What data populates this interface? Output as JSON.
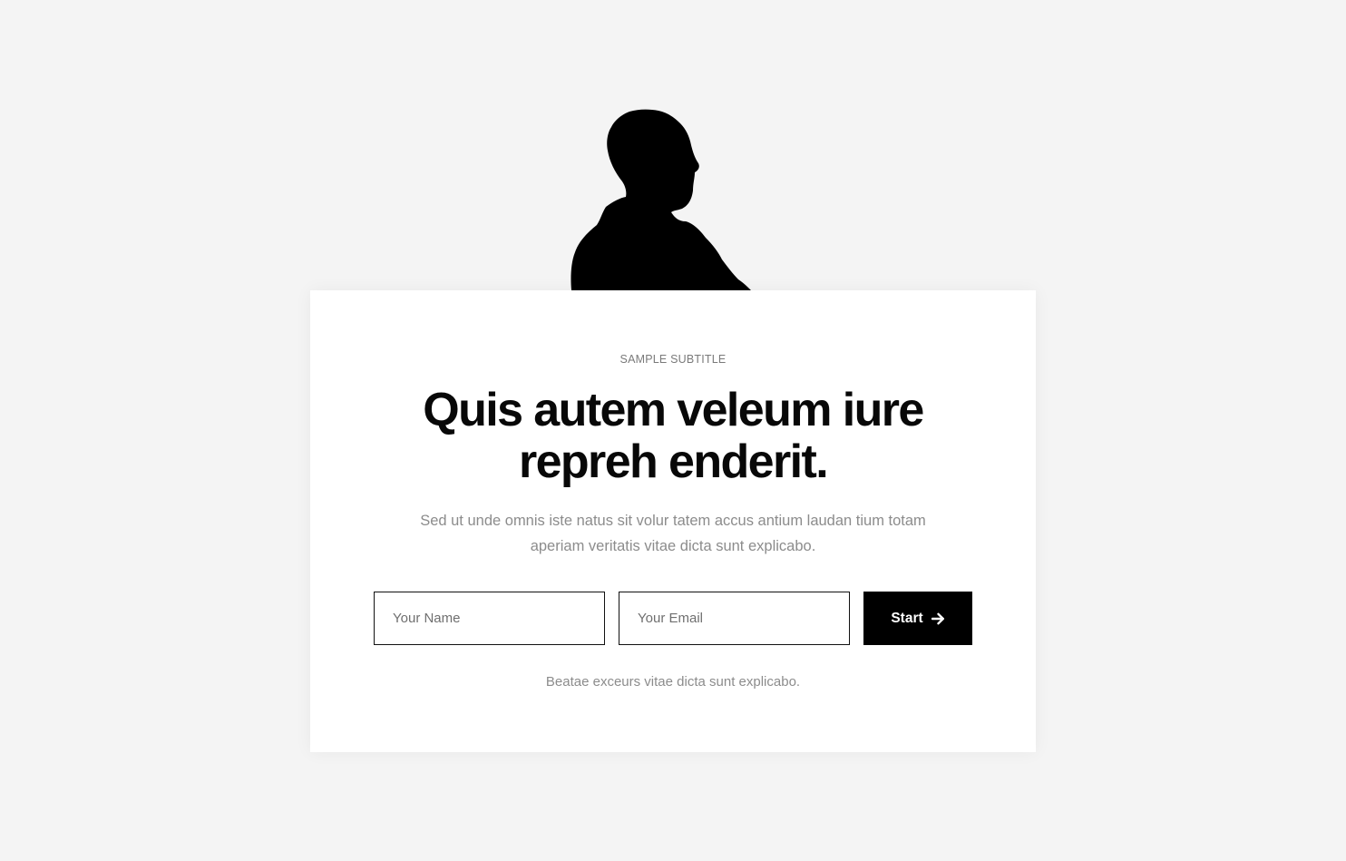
{
  "hero": {
    "image_icon": "person-silhouette"
  },
  "card": {
    "subtitle": "SAMPLE SUBTITLE",
    "headline": "Quis autem veleum iure repreh enderit.",
    "description": "Sed ut unde omnis iste natus sit volur tatem accus antium laudan tium totam aperiam veritatis vitae dicta sunt explicabo.",
    "form": {
      "name_placeholder": "Your Name",
      "email_placeholder": "Your Email",
      "submit_label": "Start",
      "submit_icon": "arrow-right-icon"
    },
    "note": "Beatae exceurs vitae dicta sunt explicabo."
  },
  "colors": {
    "background": "#f4f4f4",
    "card": "#ffffff",
    "button": "#000000",
    "text_muted": "#8c8c8c"
  }
}
